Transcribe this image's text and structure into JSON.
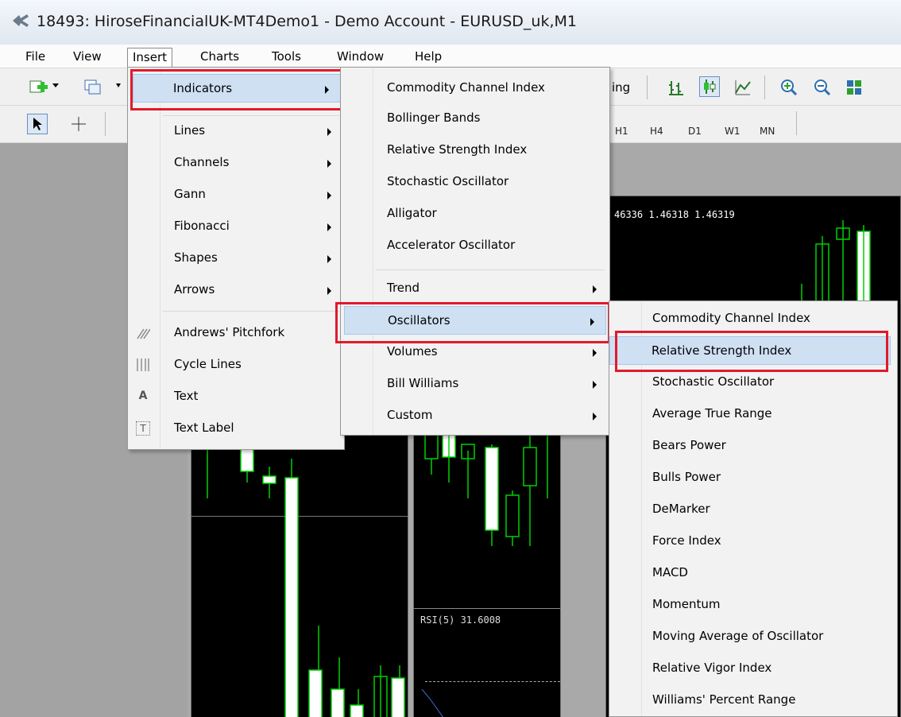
{
  "window": {
    "title": "18493: HiroseFinancialUK-MT4Demo1 - Demo Account - EURUSD_uk,M1"
  },
  "menubar": {
    "items": [
      {
        "label": "File"
      },
      {
        "label": "View"
      },
      {
        "label": "Insert"
      },
      {
        "label": "Charts"
      },
      {
        "label": "Tools"
      },
      {
        "label": "Window"
      },
      {
        "label": "Help"
      }
    ]
  },
  "toolbar": {
    "partial_label": "ing",
    "timeframes": [
      "H1",
      "H4",
      "D1",
      "W1",
      "MN"
    ]
  },
  "charts": {
    "price_readout": "46336 1.46318 1.46319",
    "rsi_label": "RSI(5) 31.6008"
  },
  "insert_menu": {
    "items": [
      {
        "label": "Indicators"
      },
      {
        "label": "Lines"
      },
      {
        "label": "Channels"
      },
      {
        "label": "Gann"
      },
      {
        "label": "Fibonacci"
      },
      {
        "label": "Shapes"
      },
      {
        "label": "Arrows"
      },
      {
        "label": "Andrews' Pitchfork"
      },
      {
        "label": "Cycle Lines"
      },
      {
        "label": "Text"
      },
      {
        "label": "Text Label"
      }
    ],
    "icons": {
      "pitchfork": "pitchfork-icon",
      "cycle": "cycle-lines-icon",
      "text": "A",
      "text_label": "T"
    }
  },
  "indicators_menu": {
    "items": [
      {
        "label": "Commodity Channel Index"
      },
      {
        "label": "Bollinger Bands"
      },
      {
        "label": "Relative Strength Index"
      },
      {
        "label": "Stochastic Oscillator"
      },
      {
        "label": "Alligator"
      },
      {
        "label": "Accelerator Oscillator"
      },
      {
        "label": "Trend"
      },
      {
        "label": "Oscillators"
      },
      {
        "label": "Volumes"
      },
      {
        "label": "Bill Williams"
      },
      {
        "label": "Custom"
      }
    ]
  },
  "oscillators_menu": {
    "items": [
      {
        "label": "Commodity Channel Index"
      },
      {
        "label": "Relative Strength Index"
      },
      {
        "label": "Stochastic Oscillator"
      },
      {
        "label": "Average True Range"
      },
      {
        "label": "Bears Power"
      },
      {
        "label": "Bulls Power"
      },
      {
        "label": "DeMarker"
      },
      {
        "label": "Force Index"
      },
      {
        "label": "MACD"
      },
      {
        "label": "Momentum"
      },
      {
        "label": "Moving Average of Oscillator"
      },
      {
        "label": "Relative Vigor Index"
      },
      {
        "label": "Williams' Percent Range"
      }
    ]
  },
  "colors": {
    "highlight": "#cfe0f3",
    "annotation_red": "#e11a2b",
    "candle_green": "#00d000",
    "chart_bg": "#000000"
  }
}
